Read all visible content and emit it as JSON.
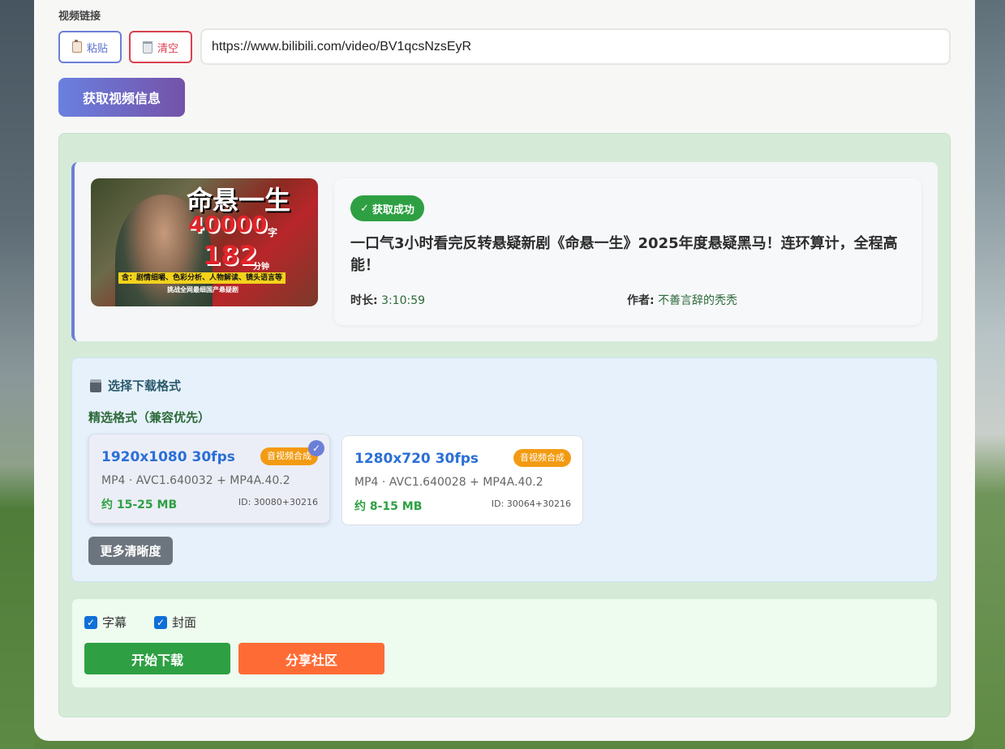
{
  "form": {
    "label": "视频链接",
    "paste_label": "粘贴",
    "clear_label": "清空",
    "url_value": "https://www.bilibili.com/video/BV1qcsNzsEyR",
    "fetch_label": "获取视频信息"
  },
  "video": {
    "status": "获取成功",
    "title": "一口气3小时看完反转悬疑新剧《命悬一生》2025年度悬疑黑马！连环算计，全程高能！",
    "duration_label": "时长:",
    "duration": "3:10:59",
    "author_label": "作者:",
    "author": "不善言辞的秃秃",
    "thumbnail": {
      "title": "命悬一生",
      "num1": "40000",
      "unit1": "字",
      "num2": "182",
      "unit2": "分钟",
      "band": "含：剧情细嚼、色彩分析、人物解读、镜头语言等",
      "sub": "挑战全网最细国产悬疑剧"
    }
  },
  "formats": {
    "heading": "选择下载格式",
    "subheading": "精选格式（兼容优先）",
    "items": [
      {
        "resolution": "1920x1080 30fps",
        "tag": "音视频合成",
        "codec": "MP4 · AVC1.640032 + MP4A.40.2",
        "size": "约 15-25 MB",
        "id": "ID: 30080+30216",
        "selected": true
      },
      {
        "resolution": "1280x720 30fps",
        "tag": "音视频合成",
        "codec": "MP4 · AVC1.640028 + MP4A.40.2",
        "size": "约 8-15 MB",
        "id": "ID: 30064+30216",
        "selected": false
      }
    ],
    "more_label": "更多清晰度"
  },
  "options": {
    "subtitle_label": "字幕",
    "subtitle_checked": true,
    "cover_label": "封面",
    "cover_checked": true,
    "download_label": "开始下载",
    "share_label": "分享社区"
  },
  "colors": {
    "accent": "#6c7fd8",
    "success": "#2ea043",
    "danger": "#d9414f",
    "orange": "#ff6b35",
    "tag": "#f29b12"
  }
}
